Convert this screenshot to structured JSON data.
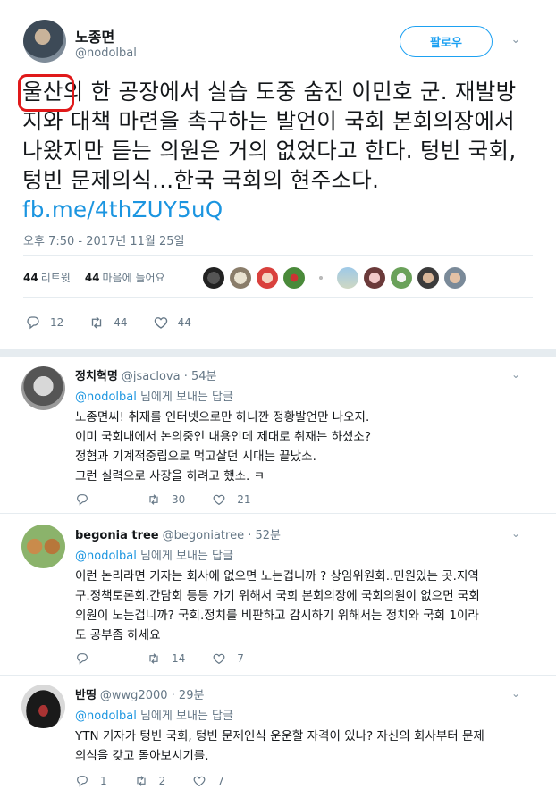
{
  "main": {
    "display_name": "노종면",
    "handle": "@nodolbal",
    "follow_label": "팔로우",
    "caret": "⌄",
    "text_highlight": "울산",
    "text_rest": "의 한 공장에서 실습 도중 숨진 이민호 군. 재발방지와 대책 마련을 촉구하는 발언이 국회 본회의장에서 나왔지만 듣는 의원은 거의 없었다고 한다. 텅빈 국회, 텅빈 문제의식...한국 국회의 현주소다. ",
    "link": "fb.me/4thZUY5uQ",
    "timestamp": "오후 7:50 - 2017년 11월 25일",
    "retweet_count": "44",
    "retweet_label": "리트윗",
    "like_count": "44",
    "like_label": "마음에 들어요",
    "reply_count": "12",
    "rt_action_count": "44",
    "like_action_count": "44"
  },
  "replies": [
    {
      "name": "정치혁명",
      "handle": "@jsaclova",
      "time": "· 54분",
      "to_link": "@nodolbal",
      "to_suffix": " 님에게 보내는 답글",
      "lines": [
        "노종면씨! 취재를 인터넷으로만 하니깐 정황발언만 나오지.",
        "이미 국회내에서 논의중인 내용인데 제대로 취재는 하셨소?",
        "정혐과 기계적중립으로 먹고살던 시대는 끝났소.",
        "그런 실력으로 사장을 하려고 했소. ㅋ"
      ],
      "reply_count": "",
      "rt_count": "30",
      "like_count": "21"
    },
    {
      "name": "begonia tree",
      "handle": "@begoniatree",
      "time": "· 52분",
      "to_link": "@nodolbal",
      "to_suffix": " 님에게 보내는 답글",
      "lines": [
        "이런 논리라면 기자는 회사에 없으면 노는겁니까 ? 상임위원회..민원있는 곳.지역",
        "구.정책토론회.간담회 등등 가기 위해서 국회 본회의장에 국회의원이 없으면 국회",
        "의원이 노는겁니까? 국회.정치를 비판하고 감시하기 위해서는 정치와 국회 1이라",
        "도 공부좀 하세요"
      ],
      "reply_count": "",
      "rt_count": "14",
      "like_count": "7"
    },
    {
      "name": "반띵",
      "handle": "@wwg2000",
      "time": "· 29분",
      "to_link": "@nodolbal",
      "to_suffix": " 님에게 보내는 답글",
      "lines": [
        "YTN 기자가 텅빈 국회, 텅빈 문제인식 운운할 자격이 있나? 자신의 회사부터 문제",
        "의식을 갖고 돌아보시기를."
      ],
      "reply_count": "1",
      "rt_count": "2",
      "like_count": "7"
    }
  ],
  "icons": {
    "reply": "reply-icon",
    "retweet": "retweet-icon",
    "like": "heart-icon"
  },
  "colors": {
    "accent": "#1da1f2",
    "link": "#1b95e0",
    "secondary_text": "#657786",
    "highlight_box": "#e0191a"
  }
}
